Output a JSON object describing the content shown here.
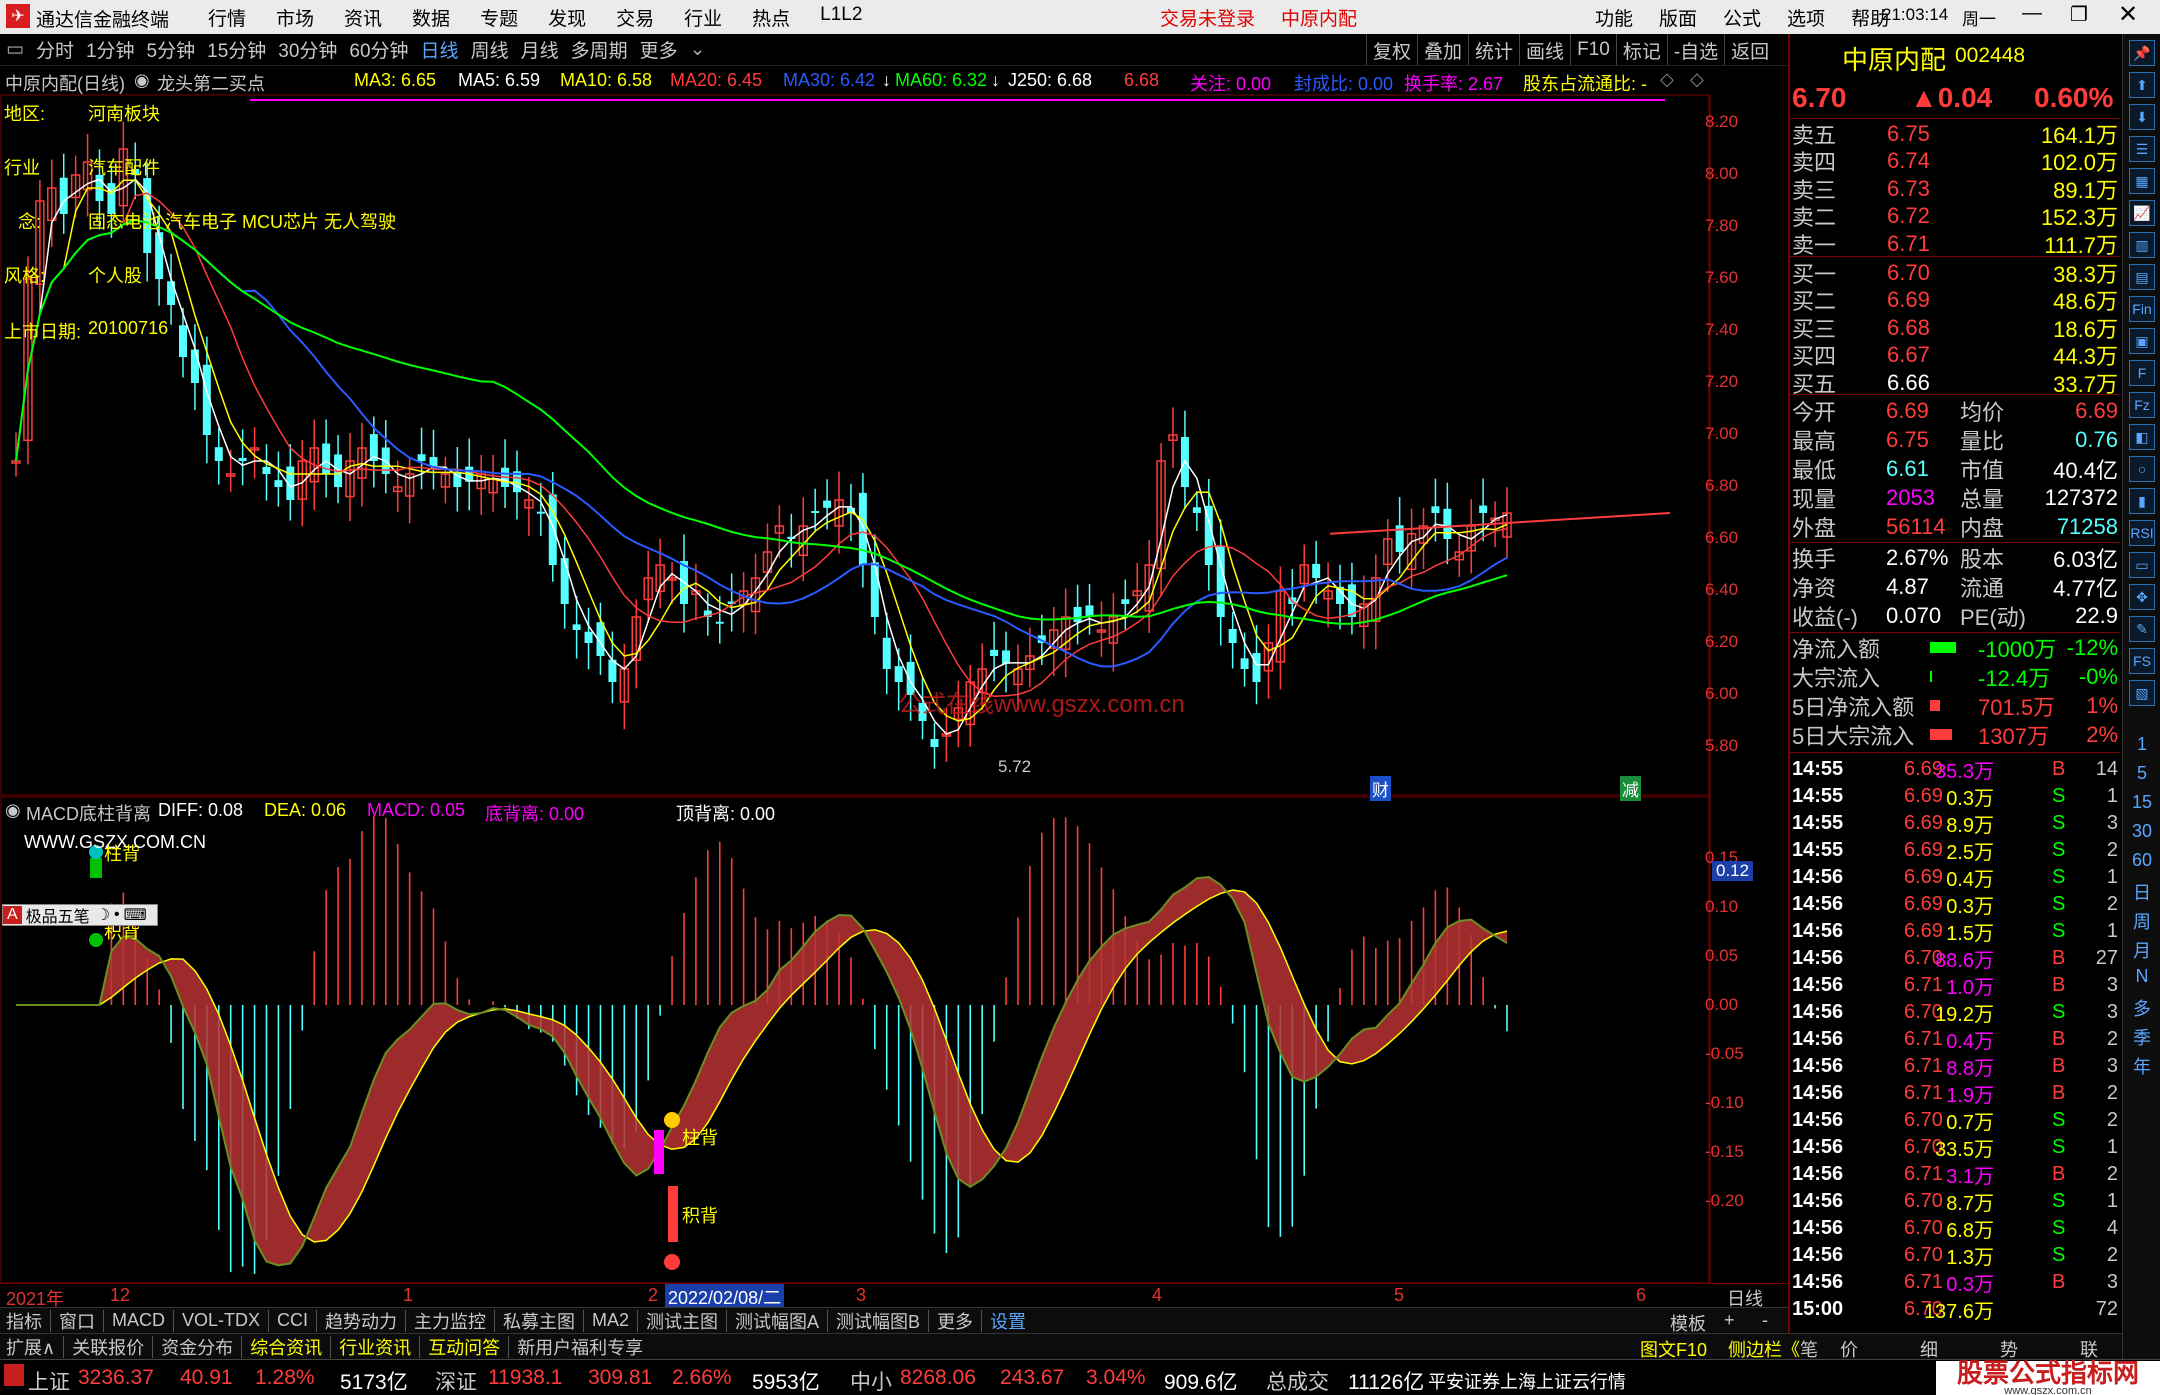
{
  "titlebar": {
    "app_title": "通达信金融终端",
    "menu": [
      "行情",
      "市场",
      "资讯",
      "数据",
      "专题",
      "发现",
      "交易",
      "行业",
      "热点",
      "L1L2"
    ],
    "login_status": "交易未登录",
    "stock_name": "中原内配",
    "right_menu": [
      "功能",
      "版面",
      "公式",
      "选项",
      "帮助"
    ],
    "time": "21:03:14",
    "weekday": "周一"
  },
  "periodbar": {
    "items": [
      "分时",
      "1分钟",
      "5分钟",
      "15分钟",
      "30分钟",
      "60分钟",
      "日线",
      "周线",
      "月线",
      "多周期",
      "更多"
    ],
    "active": "日线",
    "right_items": [
      "复权",
      "叠加",
      "统计",
      "画线",
      "F10",
      "标记",
      "-自选",
      "返回"
    ]
  },
  "infobar": {
    "stock_label": "中原内配(日线)",
    "formula": "龙头第二买点",
    "ma3": "MA3: 6.65",
    "ma5": "MA5: 6.59",
    "ma10": "MA10: 6.58",
    "ma20": "MA20: 6.45",
    "ma30": "MA30: 6.42",
    "ma60": "MA60: 6.32",
    "j250": "J250: 6.68",
    "val": "6.68",
    "guanzhu": "关注: 0.00",
    "fengcheng": "封成比: 0.00",
    "huanshou": "换手率: 2.67",
    "gudong": "股东占流通比: -"
  },
  "overlay": {
    "region_label": "地区:",
    "region_value": "河南板块",
    "industry_label": "行业",
    "industry_value": "汽车配件",
    "concept_label": "念:",
    "concept_value": "固态电池 汽车电子 MCU芯片 无人驾驶",
    "style_label": "风格:",
    "style_value": "个人股",
    "list_label": "上市日期:",
    "list_value": "20100716",
    "watermark": "公式在线www.gszx.com.cn",
    "low_label": "5.72",
    "cai_marker": "财",
    "jian_marker": "减"
  },
  "price_axis": [
    "8.20",
    "8.00",
    "7.80",
    "7.60",
    "7.40",
    "7.20",
    "7.00",
    "6.80",
    "6.60",
    "6.40",
    "6.20",
    "6.00",
    "5.80"
  ],
  "macd": {
    "title": "MACD底柱背离",
    "diff": "DIFF: 0.08",
    "dea": "DEA: 0.06",
    "macd": "MACD: 0.05",
    "dibeili": "底背离: 0.00",
    "dingbeili": "顶背离: 0.00",
    "watermark": "WWW.GSZX.COM.CN",
    "zhubei1": "柱背",
    "zhubei2": "柱背",
    "jibei1": "积背",
    "jibei2": "积背",
    "current_value": "0.12",
    "toolbox": "极品五笔",
    "axis": [
      "0.15",
      "0.10",
      "0.05",
      "0.00",
      "-0.05",
      "-0.10",
      "-0.15",
      "-0.20"
    ]
  },
  "dateaxis": {
    "labels": [
      "2021年",
      "12",
      "1",
      "2",
      "3",
      "4",
      "5",
      "6"
    ],
    "cursor_date": "2022/02/08/二",
    "period": "日线"
  },
  "tabs": {
    "items": [
      "指标",
      "窗口",
      "MACD",
      "VOL-TDX",
      "CCI",
      "趋势动力",
      "主力监控",
      "私募主图",
      "MA2",
      "测试主图",
      "测试幅图A",
      "测试幅图B",
      "更多",
      "设置"
    ],
    "right": [
      "模板",
      "+",
      "-"
    ]
  },
  "bottombar": {
    "items": [
      "扩展∧",
      "关联报价",
      "资金分布",
      "综合资讯",
      "行业资讯",
      "互动问答",
      "新用户福利专享"
    ],
    "right": [
      "图文F10",
      "侧边栏《",
      "笔",
      "价",
      "细",
      "势",
      "联"
    ]
  },
  "status": {
    "sh_label": "上证",
    "sh_value": "3236.37",
    "sh_change": "40.91",
    "sh_pct": "1.28%",
    "sh_amount": "5173亿",
    "sz_label": "深证",
    "sz_value": "11938.1",
    "sz_change": "309.81",
    "sz_pct": "2.66%",
    "sz_amount": "5953亿",
    "zx_label": "中小",
    "zx_value": "8268.06",
    "zx_change": "243.67",
    "zx_pct": "3.04%",
    "zx_amount": "909.6亿",
    "total_label": "总成交",
    "total_value": "11126亿",
    "news": "平安证券上海上证云行情",
    "brand": "股票公式指标网",
    "brand_url": "www.gszx.com.cn"
  },
  "quote": {
    "name": "中原内配",
    "code": "002448",
    "price": "6.70",
    "change": "▲0.04",
    "pct": "0.60%",
    "asks": [
      {
        "label": "卖五",
        "price": "6.75",
        "vol": "164.1万"
      },
      {
        "label": "卖四",
        "price": "6.74",
        "vol": "102.0万"
      },
      {
        "label": "卖三",
        "price": "6.73",
        "vol": "89.1万"
      },
      {
        "label": "卖二",
        "price": "6.72",
        "vol": "152.3万"
      },
      {
        "label": "卖一",
        "price": "6.71",
        "vol": "111.7万"
      }
    ],
    "bids": [
      {
        "label": "买一",
        "price": "6.70",
        "vol": "38.3万"
      },
      {
        "label": "买二",
        "price": "6.69",
        "vol": "48.6万"
      },
      {
        "label": "买三",
        "price": "6.68",
        "vol": "18.6万"
      },
      {
        "label": "买四",
        "price": "6.67",
        "vol": "44.3万"
      },
      {
        "label": "买五",
        "price": "6.66",
        "vol": "33.7万"
      }
    ],
    "stats": [
      {
        "l1": "今开",
        "v1": "6.69",
        "l2": "均价",
        "v2": "6.69"
      },
      {
        "l1": "最高",
        "v1": "6.75",
        "l2": "量比",
        "v2": "0.76"
      },
      {
        "l1": "最低",
        "v1": "6.61",
        "l2": "市值",
        "v2": "40.4亿"
      },
      {
        "l1": "现量",
        "v1": "2053",
        "l2": "总量",
        "v2": "127372"
      },
      {
        "l1": "外盘",
        "v1": "56114",
        "l2": "内盘",
        "v2": "71258"
      }
    ],
    "stats2": [
      {
        "l1": "换手",
        "v1": "2.67%",
        "l2": "股本",
        "v2": "6.03亿"
      },
      {
        "l1": "净资",
        "v1": "4.87",
        "l2": "流通",
        "v2": "4.77亿"
      },
      {
        "l1": "收益(-)",
        "v1": "0.070",
        "l2": "PE(动)",
        "v2": "22.9"
      }
    ],
    "flows": [
      {
        "label": "净流入额",
        "value": "-1000万",
        "pct": "-12%"
      },
      {
        "label": "大宗流入",
        "value": "-12.4万",
        "pct": "-0%"
      },
      {
        "label": "5日净流入额",
        "value": "701.5万",
        "pct": "1%"
      },
      {
        "label": "5日大宗流入",
        "value": "1307万",
        "pct": "2%"
      }
    ],
    "ticks": [
      {
        "t": "14:55",
        "p": "6.69",
        "v": "35.3万",
        "s": "B",
        "n": "14"
      },
      {
        "t": "14:55",
        "p": "6.69",
        "v": "0.3万",
        "s": "S",
        "n": "1"
      },
      {
        "t": "14:55",
        "p": "6.69",
        "v": "8.9万",
        "s": "S",
        "n": "3"
      },
      {
        "t": "14:55",
        "p": "6.69",
        "v": "2.5万",
        "s": "S",
        "n": "2"
      },
      {
        "t": "14:56",
        "p": "6.69",
        "v": "0.4万",
        "s": "S",
        "n": "1"
      },
      {
        "t": "14:56",
        "p": "6.69",
        "v": "0.3万",
        "s": "S",
        "n": "2"
      },
      {
        "t": "14:56",
        "p": "6.69",
        "v": "1.5万",
        "s": "S",
        "n": "1"
      },
      {
        "t": "14:56",
        "p": "6.70",
        "v": "88.6万",
        "s": "B",
        "n": "27"
      },
      {
        "t": "14:56",
        "p": "6.71",
        "v": "1.0万",
        "s": "B",
        "n": "3"
      },
      {
        "t": "14:56",
        "p": "6.70",
        "v": "19.2万",
        "s": "S",
        "n": "3"
      },
      {
        "t": "14:56",
        "p": "6.71",
        "v": "0.4万",
        "s": "B",
        "n": "2"
      },
      {
        "t": "14:56",
        "p": "6.71",
        "v": "8.8万",
        "s": "B",
        "n": "3"
      },
      {
        "t": "14:56",
        "p": "6.71",
        "v": "1.9万",
        "s": "B",
        "n": "2"
      },
      {
        "t": "14:56",
        "p": "6.70",
        "v": "0.7万",
        "s": "S",
        "n": "2"
      },
      {
        "t": "14:56",
        "p": "6.70",
        "v": "33.5万",
        "s": "S",
        "n": "1"
      },
      {
        "t": "14:56",
        "p": "6.71",
        "v": "3.1万",
        "s": "B",
        "n": "2"
      },
      {
        "t": "14:56",
        "p": "6.70",
        "v": "8.7万",
        "s": "S",
        "n": "1"
      },
      {
        "t": "14:56",
        "p": "6.70",
        "v": "6.8万",
        "s": "S",
        "n": "4"
      },
      {
        "t": "14:56",
        "p": "6.70",
        "v": "1.3万",
        "s": "S",
        "n": "2"
      },
      {
        "t": "14:56",
        "p": "6.71",
        "v": "0.3万",
        "s": "B",
        "n": "3"
      },
      {
        "t": "15:00",
        "p": "6.70",
        "v": "137.6万",
        "s": "",
        "n": "72"
      }
    ]
  },
  "sidebar_labels": [
    "1",
    "5",
    "15",
    "30",
    "60",
    "日",
    "周",
    "月",
    "N",
    "多",
    "季",
    "年"
  ],
  "colors": {
    "up": "#ff3c3c",
    "down": "#54ffff",
    "ma3": "#ffffff",
    "ma5": "#ffff00",
    "ma10": "#ff00ff",
    "ma20": "#ff3c3c",
    "ma60": "#00ff00",
    "ma30": "#2a5bff"
  }
}
